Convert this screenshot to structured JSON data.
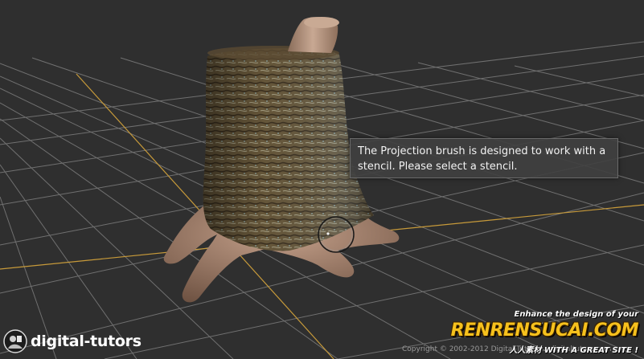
{
  "viewport": {
    "tooltip_text": "The Projection brush is designed to work with a stencil. Please select a stencil.",
    "colors": {
      "background": "#2f2f2f",
      "grid": "#6e6e6e",
      "grid_axis": "#c79a3a",
      "stump_skin": "#9c7a66",
      "bark": "#6b5a3a"
    }
  },
  "branding": {
    "logo_text": "digital-tutors",
    "logo_icon": "digital-tutors-logo-icon",
    "copyright": "Copyright © 2002-2012 Digital-Tutors ... digitaltutors.com"
  },
  "watermark": {
    "tagline_top": "Enhance the design of your",
    "main": "RENRENSUCAI.COM",
    "tagline_bottom": "人人素材  WITH A GREAT SITE !"
  }
}
